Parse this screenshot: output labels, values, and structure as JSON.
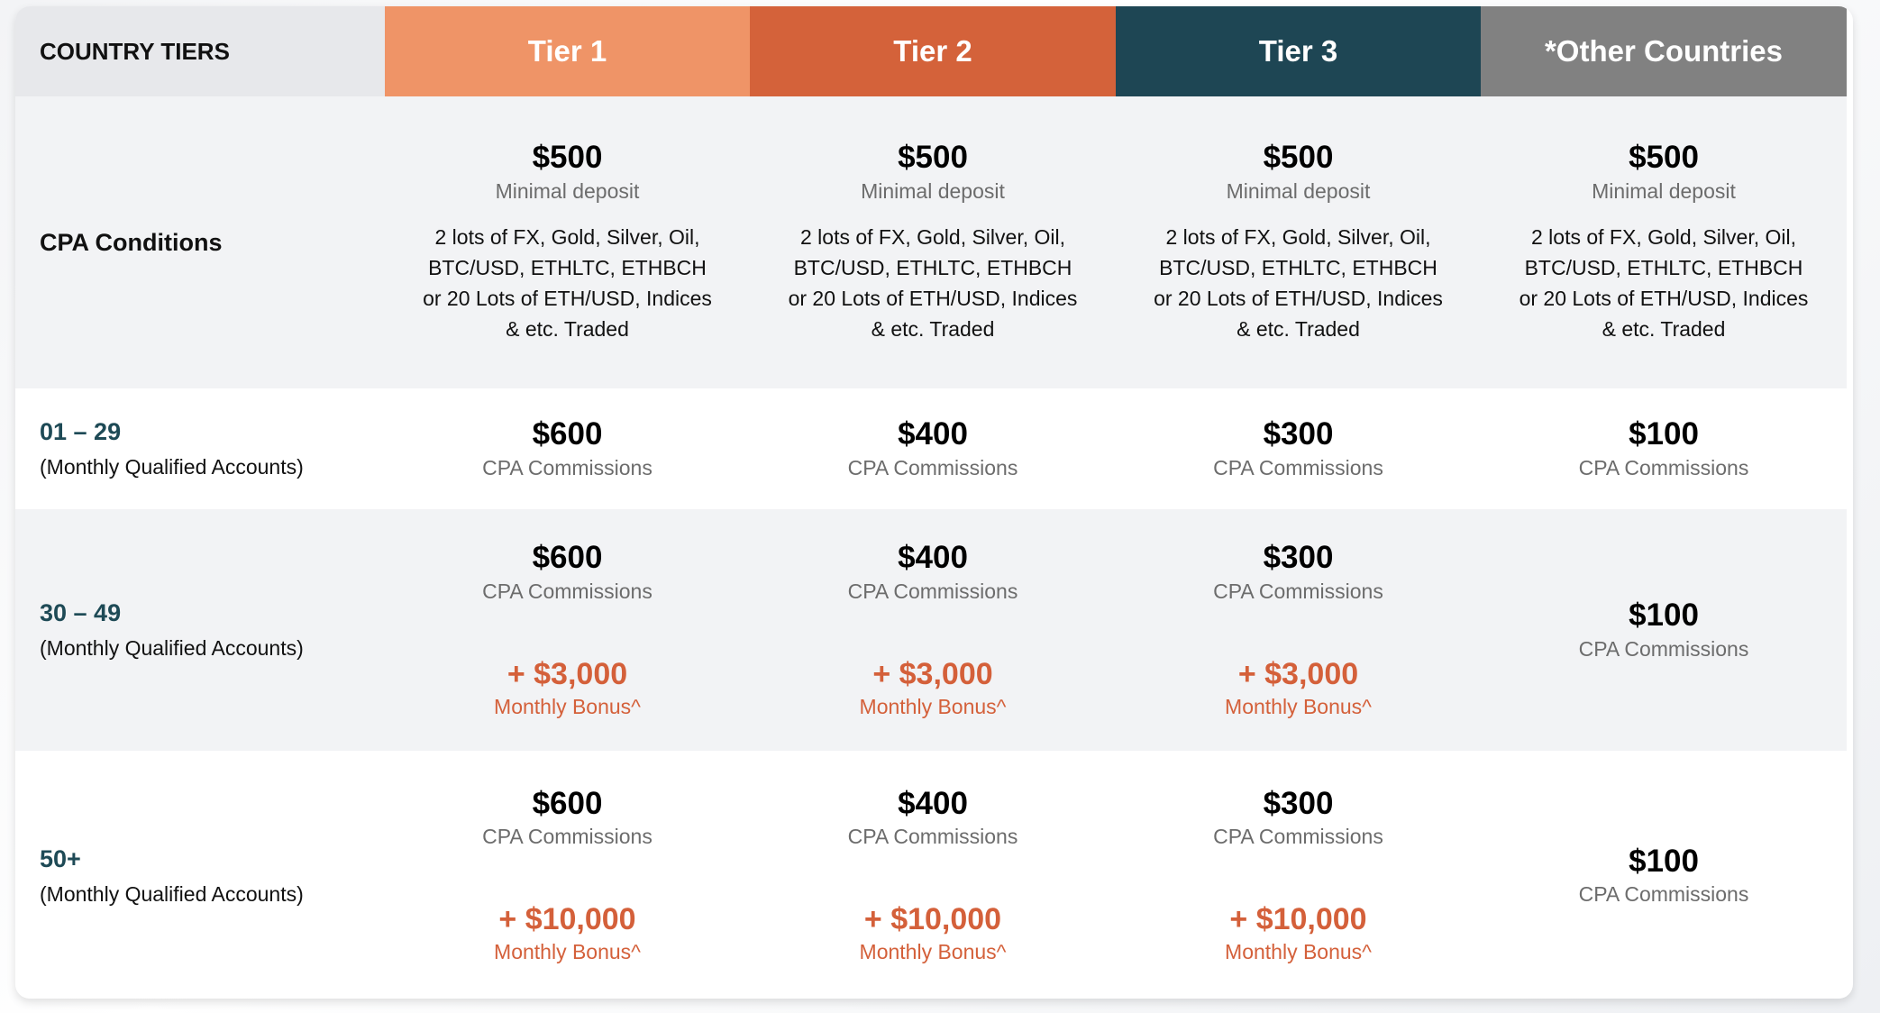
{
  "header": {
    "label": "COUNTRY TIERS",
    "tiers": [
      {
        "name": "Tier 1",
        "color": "#ef9467"
      },
      {
        "name": "Tier 2",
        "color": "#d4623a"
      },
      {
        "name": "Tier 3",
        "color": "#1e4654"
      },
      {
        "name": "*Other Countries",
        "color": "#818181"
      }
    ]
  },
  "cpa_conditions": {
    "label": "CPA Conditions",
    "cells": [
      {
        "amount": "$500",
        "amount_label": "Minimal deposit",
        "conditions": "2 lots of FX, Gold, Silver, Oil, BTC/USD, ETHLTC, ETHBCH or 20 Lots of ETH/USD, Indices & etc. Traded"
      },
      {
        "amount": "$500",
        "amount_label": "Minimal deposit",
        "conditions": "2 lots of FX, Gold, Silver, Oil, BTC/USD, ETHLTC, ETHBCH or 20 Lots of ETH/USD, Indices & etc. Traded"
      },
      {
        "amount": "$500",
        "amount_label": "Minimal deposit",
        "conditions": "2 lots of FX, Gold, Silver, Oil, BTC/USD, ETHLTC, ETHBCH or 20 Lots of ETH/USD, Indices & etc. Traded"
      },
      {
        "amount": "$500",
        "amount_label": "Minimal deposit",
        "conditions": "2 lots of FX, Gold, Silver, Oil, BTC/USD, ETHLTC, ETHBCH or 20 Lots of ETH/USD, Indices & etc. Traded"
      }
    ]
  },
  "rows": [
    {
      "range": "01 – 29",
      "range_label": "(Monthly Qualified Accounts)",
      "cells": [
        {
          "amount": "$600",
          "amount_label": "CPA Commissions"
        },
        {
          "amount": "$400",
          "amount_label": "CPA Commissions"
        },
        {
          "amount": "$300",
          "amount_label": "CPA Commissions"
        },
        {
          "amount": "$100",
          "amount_label": "CPA Commissions"
        }
      ]
    },
    {
      "range": "30 – 49",
      "range_label": "(Monthly Qualified Accounts)",
      "cells": [
        {
          "amount": "$600",
          "amount_label": "CPA Commissions",
          "bonus": "+ $3,000",
          "bonus_label": "Monthly Bonus^"
        },
        {
          "amount": "$400",
          "amount_label": "CPA Commissions",
          "bonus": "+ $3,000",
          "bonus_label": "Monthly Bonus^"
        },
        {
          "amount": "$300",
          "amount_label": "CPA Commissions",
          "bonus": "+ $3,000",
          "bonus_label": "Monthly Bonus^"
        },
        {
          "amount": "$100",
          "amount_label": "CPA Commissions"
        }
      ]
    },
    {
      "range": "50+",
      "range_label": "(Monthly Qualified Accounts)",
      "cells": [
        {
          "amount": "$600",
          "amount_label": "CPA Commissions",
          "bonus": "+ $10,000",
          "bonus_label": "Monthly Bonus^"
        },
        {
          "amount": "$400",
          "amount_label": "CPA Commissions",
          "bonus": "+ $10,000",
          "bonus_label": "Monthly Bonus^"
        },
        {
          "amount": "$300",
          "amount_label": "CPA Commissions",
          "bonus": "+ $10,000",
          "bonus_label": "Monthly Bonus^"
        },
        {
          "amount": "$100",
          "amount_label": "CPA Commissions"
        }
      ]
    }
  ]
}
